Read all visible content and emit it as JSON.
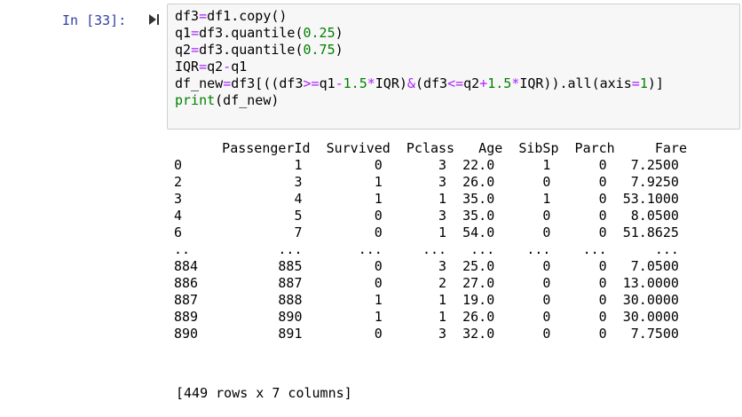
{
  "cell": {
    "prompt": "In [33]:",
    "code_lines": [
      [
        {
          "t": "df3"
        },
        {
          "t": "=",
          "c": "op"
        },
        {
          "t": "df1.copy()"
        }
      ],
      [
        {
          "t": "q1"
        },
        {
          "t": "=",
          "c": "op"
        },
        {
          "t": "df3.quantile("
        },
        {
          "t": "0.25",
          "c": "num"
        },
        {
          "t": ")"
        }
      ],
      [
        {
          "t": "q2"
        },
        {
          "t": "=",
          "c": "op"
        },
        {
          "t": "df3.quantile("
        },
        {
          "t": "0.75",
          "c": "num"
        },
        {
          "t": ")"
        }
      ],
      [
        {
          "t": "IQR"
        },
        {
          "t": "=",
          "c": "op"
        },
        {
          "t": "q2"
        },
        {
          "t": "-",
          "c": "op"
        },
        {
          "t": "q1"
        }
      ],
      [
        {
          "t": "df_new"
        },
        {
          "t": "=",
          "c": "op"
        },
        {
          "t": "df3[((df3"
        },
        {
          "t": ">=",
          "c": "op"
        },
        {
          "t": "q1"
        },
        {
          "t": "-",
          "c": "op"
        },
        {
          "t": "1.5",
          "c": "num"
        },
        {
          "t": "*",
          "c": "op"
        },
        {
          "t": "IQR)"
        },
        {
          "t": "&",
          "c": "op"
        },
        {
          "t": "(df3"
        },
        {
          "t": "<=",
          "c": "op"
        },
        {
          "t": "q2"
        },
        {
          "t": "+",
          "c": "op"
        },
        {
          "t": "1.5",
          "c": "num"
        },
        {
          "t": "*",
          "c": "op"
        },
        {
          "t": "IQR)).all(axis"
        },
        {
          "t": "=",
          "c": "op"
        },
        {
          "t": "1",
          "c": "num"
        },
        {
          "t": ")]"
        }
      ],
      [
        {
          "t": "print",
          "c": "builtin"
        },
        {
          "t": "(df_new)"
        }
      ]
    ]
  },
  "output": {
    "lines": [
      "      PassengerId  Survived  Pclass   Age  SibSp  Parch     Fare",
      "0              1         0       3  22.0      1      0   7.2500",
      "2              3         1       3  26.0      0      0   7.9250",
      "3              4         1       1  35.0      1      0  53.1000",
      "4              5         0       3  35.0      0      0   8.0500",
      "6              7         0       1  54.0      0      0  51.8625",
      "..           ...       ...     ...   ...    ...    ...      ...",
      "884          885         0       3  25.0      0      0   7.0500",
      "886          887         0       2  27.0      0      0  13.0000",
      "887          888         1       1  19.0      0      0  30.0000",
      "889          890         1       1  26.0      0      0  30.0000",
      "890          891         0       3  32.0      0      0   7.7500"
    ],
    "summary": "[449 rows x 7 columns]"
  },
  "colors": {
    "prompt": "#303f9f",
    "operator": "#aa22ff",
    "number": "#008000",
    "builtin": "#008000",
    "cell_background": "#f7f7f7",
    "cell_border": "#cfcfcf"
  },
  "icons": {
    "run_toggle": "collapse-toggle-icon"
  }
}
